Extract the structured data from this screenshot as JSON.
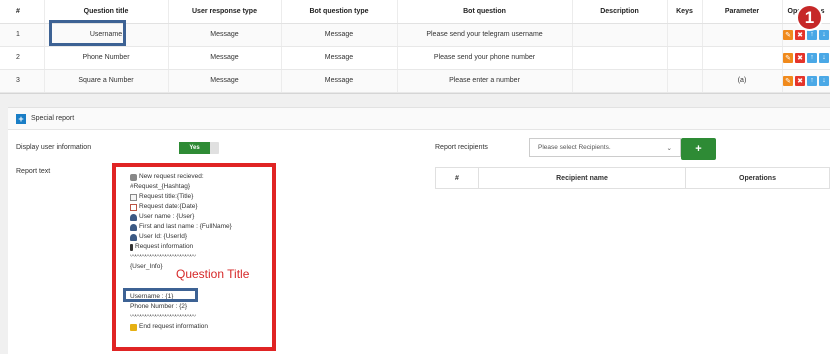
{
  "questions_table": {
    "headers": [
      "#",
      "Question title",
      "User response type",
      "Bot question type",
      "Bot question",
      "Description",
      "Keys",
      "Parameter",
      "Operations"
    ],
    "rows": [
      {
        "num": "1",
        "title": "Username",
        "user_type": "Message",
        "bot_type": "Message",
        "bot_question": "Please send your telegram username",
        "description": "",
        "keys": "",
        "parameter": ""
      },
      {
        "num": "2",
        "title": "Phone Number",
        "user_type": "Message",
        "bot_type": "Message",
        "bot_question": "Please send your phone number",
        "description": "",
        "keys": "",
        "parameter": ""
      },
      {
        "num": "3",
        "title": "Square a Number",
        "user_type": "Message",
        "bot_type": "Message",
        "bot_question": "Please enter a number",
        "description": "",
        "keys": "",
        "parameter": "(a)"
      }
    ]
  },
  "annotation": {
    "badge": "1",
    "question_title_label": "Question Title"
  },
  "special_report": {
    "title": "Special report",
    "display_user_info_label": "Display user information",
    "toggle_label": "Yes",
    "report_text_label": "Report text",
    "report_recipients_label": "Report recipients",
    "recipients_placeholder": "Please select Recipients.",
    "add_button": "+",
    "recipients_table_headers": [
      "#",
      "Recipient name",
      "Operations"
    ],
    "report_text_lines": [
      {
        "icon": "speech-icon",
        "text": "New request recieved:"
      },
      {
        "icon": "",
        "text": "#Request_{Hashtag}"
      },
      {
        "icon": "document-icon",
        "text": "Request title:{Title}"
      },
      {
        "icon": "calendar-icon",
        "text": "Request date:{Date}"
      },
      {
        "icon": "person-icon",
        "text": "User name : {User}"
      },
      {
        "icon": "person-icon",
        "text": "First and last name : {FullName}"
      },
      {
        "icon": "person-icon",
        "text": "User Id: {UserId}"
      },
      {
        "icon": "phone-icon",
        "text": "Request information"
      },
      {
        "icon": "",
        "text": "〰〰〰〰〰〰〰〰〰〰〰〰〰"
      },
      {
        "icon": "",
        "text": "{User_Info}"
      },
      {
        "icon": "",
        "text": ""
      },
      {
        "icon": "",
        "text": ""
      },
      {
        "icon": "",
        "text": "Username : {1}"
      },
      {
        "icon": "",
        "text": "Phone Number : {2}"
      },
      {
        "icon": "",
        "text": "〰〰〰〰〰〰〰〰〰〰〰〰〰"
      },
      {
        "icon": "bus-icon",
        "text": "End request information"
      }
    ]
  }
}
